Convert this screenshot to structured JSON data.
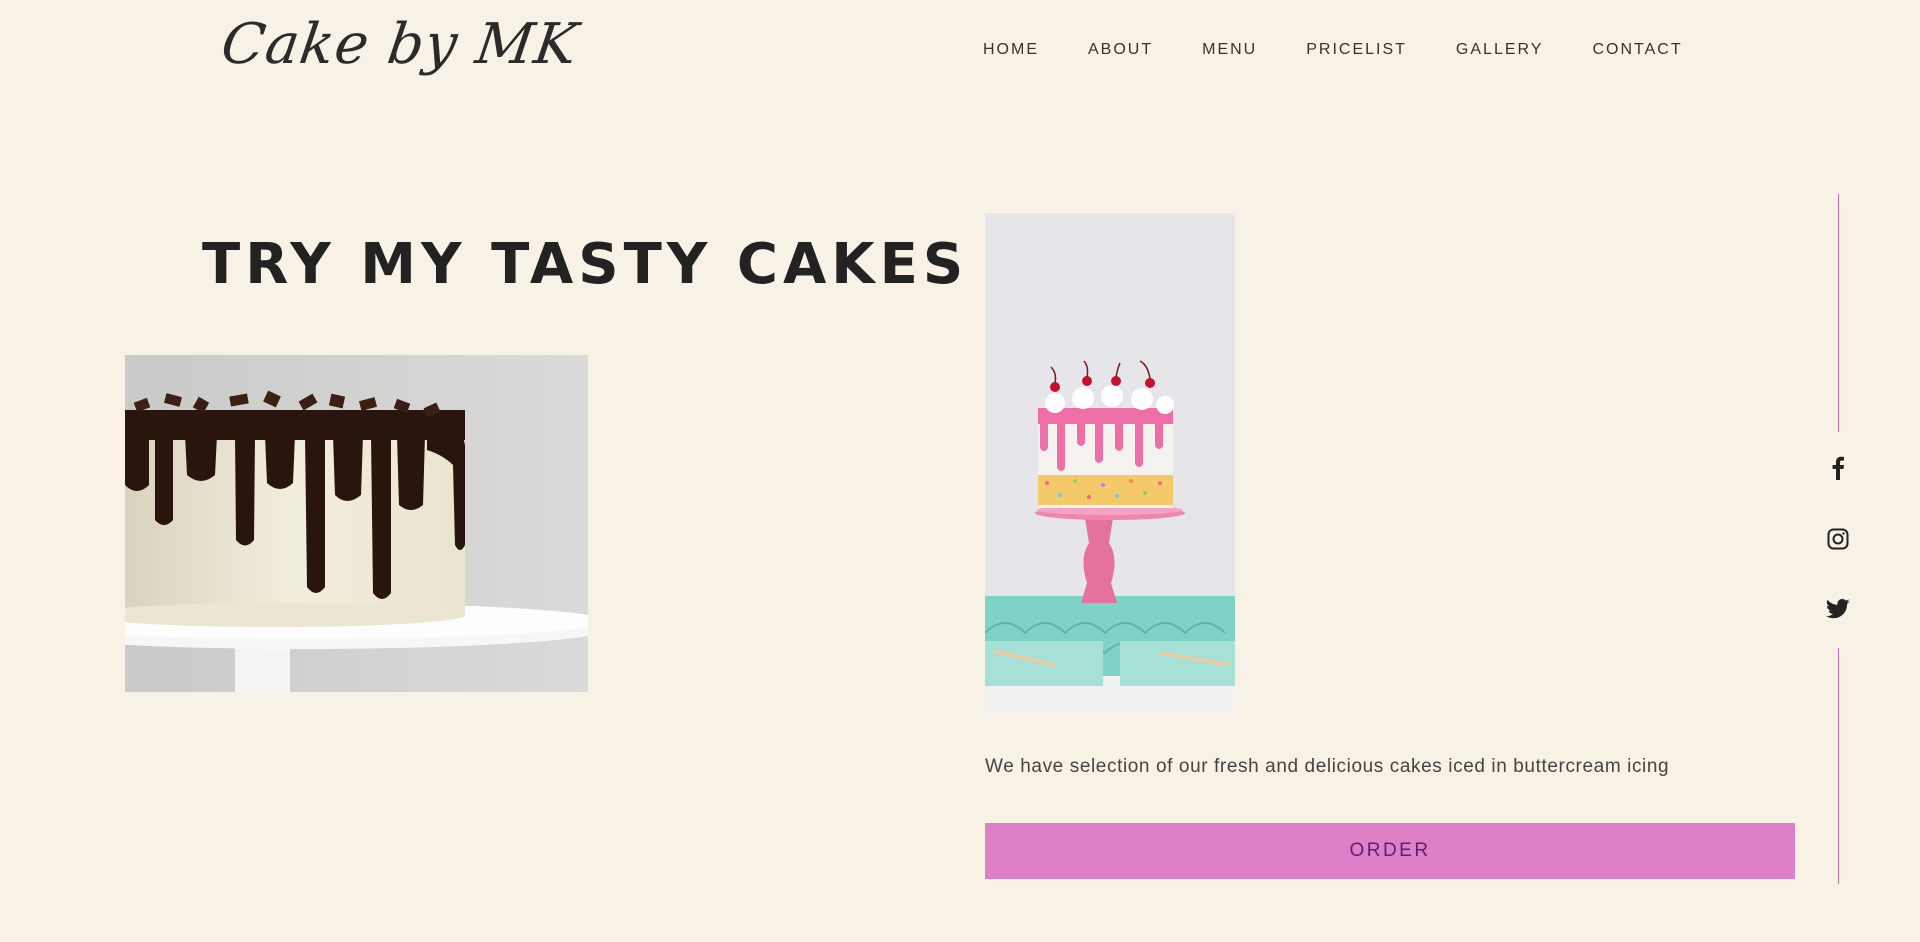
{
  "logo": {
    "text": "Cake by MK"
  },
  "nav": {
    "items": [
      {
        "label": "HOME"
      },
      {
        "label": "ABOUT"
      },
      {
        "label": "MENU"
      },
      {
        "label": "PRICELIST"
      },
      {
        "label": "GALLERY"
      },
      {
        "label": "CONTACT"
      }
    ]
  },
  "hero": {
    "headline": "TRY MY TASTY CAKES",
    "description": "We have selection of our fresh and delicious cakes iced in buttercream icing",
    "order_label": "ORDER"
  },
  "social": {
    "icons": [
      "facebook-icon",
      "instagram-icon",
      "twitter-icon"
    ]
  },
  "colors": {
    "background": "#f8f1e6",
    "accent": "#de80c7",
    "button_text": "#5b1f7a",
    "divider": "#d06bb4"
  }
}
